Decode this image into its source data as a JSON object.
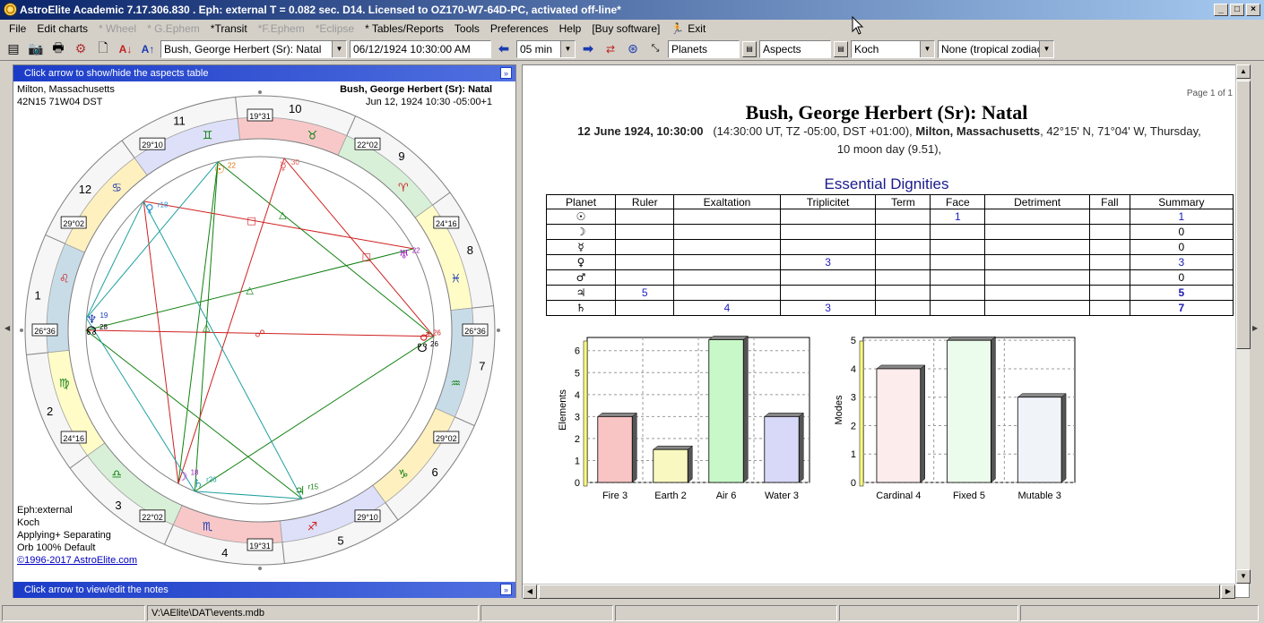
{
  "window": {
    "title": "AstroElite Academic 7.17.306.830 . Eph: external T = 0.082 sec. D14. Licensed to OZ170-W7-64D-PC, activated off-line*",
    "min": "_",
    "max": "□",
    "close": "×"
  },
  "menu": [
    {
      "label": "File",
      "disabled": false
    },
    {
      "label": "Edit charts",
      "disabled": false
    },
    {
      "label": "* Wheel",
      "disabled": true
    },
    {
      "label": "* G.Ephem",
      "disabled": true
    },
    {
      "label": "*Transit",
      "disabled": false
    },
    {
      "label": "*F.Ephem",
      "disabled": true
    },
    {
      "label": "*Eclipse",
      "disabled": true
    },
    {
      "label": "* Tables/Reports",
      "disabled": false
    },
    {
      "label": "Tools",
      "disabled": false
    },
    {
      "label": "Preferences",
      "disabled": false
    },
    {
      "label": "Help",
      "disabled": false
    },
    {
      "label": "[Buy software]",
      "disabled": false
    },
    {
      "label": "Exit",
      "disabled": false
    }
  ],
  "toolbar": {
    "chart_select": "Bush, George Herbert (Sr): Natal",
    "datetime": "06/12/1924  10:30:00 AM",
    "step": "05 min",
    "points": "Planets",
    "aspects": "Aspects",
    "houses": "Koch",
    "zodiac": "None (tropical zodiac)"
  },
  "left": {
    "top_bar": "Click arrow to show/hide the aspects table",
    "bottom_bar": "Click arrow to view/edit the notes",
    "place": "Milton, Massachusetts",
    "coords": "42N15 71W04 DST",
    "chart_name": "Bush, George Herbert (Sr): Natal",
    "chart_date": "Jun 12, 1924 10:30 -05:00+1",
    "eph": "Eph:external",
    "house_sys": "Koch",
    "applying": "Applying+ Separating",
    "orb": "Orb 100% Default",
    "copyright": "©1996-2017 AstroElite.com"
  },
  "wheel": {
    "house_numbers": [
      "10",
      "9",
      "8",
      "7",
      "6",
      "5",
      "4",
      "3",
      "2",
      "1",
      "12",
      "11"
    ],
    "cusps": [
      "19°31",
      "22°02",
      "24°16",
      "26°36",
      "29°02",
      "29°10"
    ],
    "cusp_labels": [
      "19°31",
      "22°02",
      "24°16",
      "26°36",
      "29°02",
      "29°10",
      "19°31",
      "22°02",
      "24°16",
      "26°36",
      "29°02",
      "29°10"
    ],
    "sign_glyphs": [
      "♉",
      "♈",
      "♓",
      "♒",
      "♑",
      "♐",
      "♏",
      "♎",
      "♍",
      "♌",
      "♋",
      "♊"
    ],
    "planets": [
      {
        "glyph": "☉",
        "deg": "22",
        "color": "#e07000"
      },
      {
        "glyph": "☿",
        "deg": "30",
        "color": "#e06060"
      },
      {
        "glyph": "♀",
        "deg": "r18",
        "color": "#2090d0"
      },
      {
        "glyph": "♅",
        "deg": "22",
        "color": "#a020c0"
      },
      {
        "glyph": "♆",
        "deg": "19",
        "color": "#1a3ab0"
      },
      {
        "glyph": "☊",
        "deg": "28",
        "color": "#000000"
      },
      {
        "glyph": "♂",
        "deg": "26",
        "color": "#d02020"
      },
      {
        "glyph": "☋",
        "deg": "26",
        "color": "#000000"
      },
      {
        "glyph": "☽",
        "deg": "18",
        "color": "#a020c0"
      },
      {
        "glyph": "♄",
        "deg": "r26",
        "color": "#20a0a0"
      },
      {
        "glyph": "♃",
        "deg": "r15",
        "color": "#108010"
      }
    ]
  },
  "report": {
    "page": "Page 1 of 1",
    "title": "Bush, George Herbert (Sr): Natal",
    "date_bold": "12 June 1924, 10:30:00",
    "date_rest": "(14:30:00 UT, TZ -05:00, DST +01:00),",
    "place_bold": "Milton, Massachusetts",
    "place_rest": ", 42°15' N, 71°04' W, Thursday,",
    "moon_day": "10 moon day (9.51),",
    "section": "Essential Dignities",
    "columns": [
      "Planet",
      "Ruler",
      "Exaltation",
      "Triplicitet",
      "Term",
      "Face",
      "Detriment",
      "Fall",
      "Summary"
    ],
    "rows": [
      {
        "planet": "☉",
        "ruler": "",
        "exaltation": "",
        "triplicitet": "",
        "term": "",
        "face": "1",
        "detriment": "",
        "fall": "",
        "summary": "1",
        "style": "blue"
      },
      {
        "planet": "☽",
        "ruler": "",
        "exaltation": "",
        "triplicitet": "",
        "term": "",
        "face": "",
        "detriment": "",
        "fall": "",
        "summary": "0",
        "style": "plain"
      },
      {
        "planet": "☿",
        "ruler": "",
        "exaltation": "",
        "triplicitet": "",
        "term": "",
        "face": "",
        "detriment": "",
        "fall": "",
        "summary": "0",
        "style": "plain"
      },
      {
        "planet": "♀",
        "ruler": "",
        "exaltation": "",
        "triplicitet": "3",
        "term": "",
        "face": "",
        "detriment": "",
        "fall": "",
        "summary": "3",
        "style": "blue"
      },
      {
        "planet": "♂",
        "ruler": "",
        "exaltation": "",
        "triplicitet": "",
        "term": "",
        "face": "",
        "detriment": "",
        "fall": "",
        "summary": "0",
        "style": "plain"
      },
      {
        "planet": "♃",
        "ruler": "5",
        "exaltation": "",
        "triplicitet": "",
        "term": "",
        "face": "",
        "detriment": "",
        "fall": "",
        "summary": "5",
        "style": "bold"
      },
      {
        "planet": "♄",
        "ruler": "",
        "exaltation": "4",
        "triplicitet": "3",
        "term": "",
        "face": "",
        "detriment": "",
        "fall": "",
        "summary": "7",
        "style": "bold"
      }
    ]
  },
  "chart_data": [
    {
      "type": "bar",
      "ylabel": "Elements",
      "categories": [
        "Fire 3",
        "Earth 2",
        "Air 6",
        "Water 3"
      ],
      "values": [
        3,
        1.5,
        6.5,
        3
      ],
      "colors": [
        "#f8c4c4",
        "#f8f8c0",
        "#c8f8c8",
        "#d8d8f8"
      ],
      "yticks": [
        "0",
        "1",
        "2",
        "3",
        "4",
        "5",
        "6"
      ],
      "ylim": [
        0,
        6.6
      ]
    },
    {
      "type": "bar",
      "ylabel": "Modes",
      "categories": [
        "Cardinal 4",
        "Fixed 5",
        "Mutable 3"
      ],
      "values": [
        4,
        5,
        3
      ],
      "colors": [
        "#fcecec",
        "#ecfcec",
        "#f0f4f8"
      ],
      "yticks": [
        "0",
        "1",
        "2",
        "3",
        "4",
        "5"
      ],
      "ylim": [
        0,
        5.1
      ]
    }
  ],
  "status": {
    "path": "V:\\AElite\\DAT\\events.mdb"
  }
}
